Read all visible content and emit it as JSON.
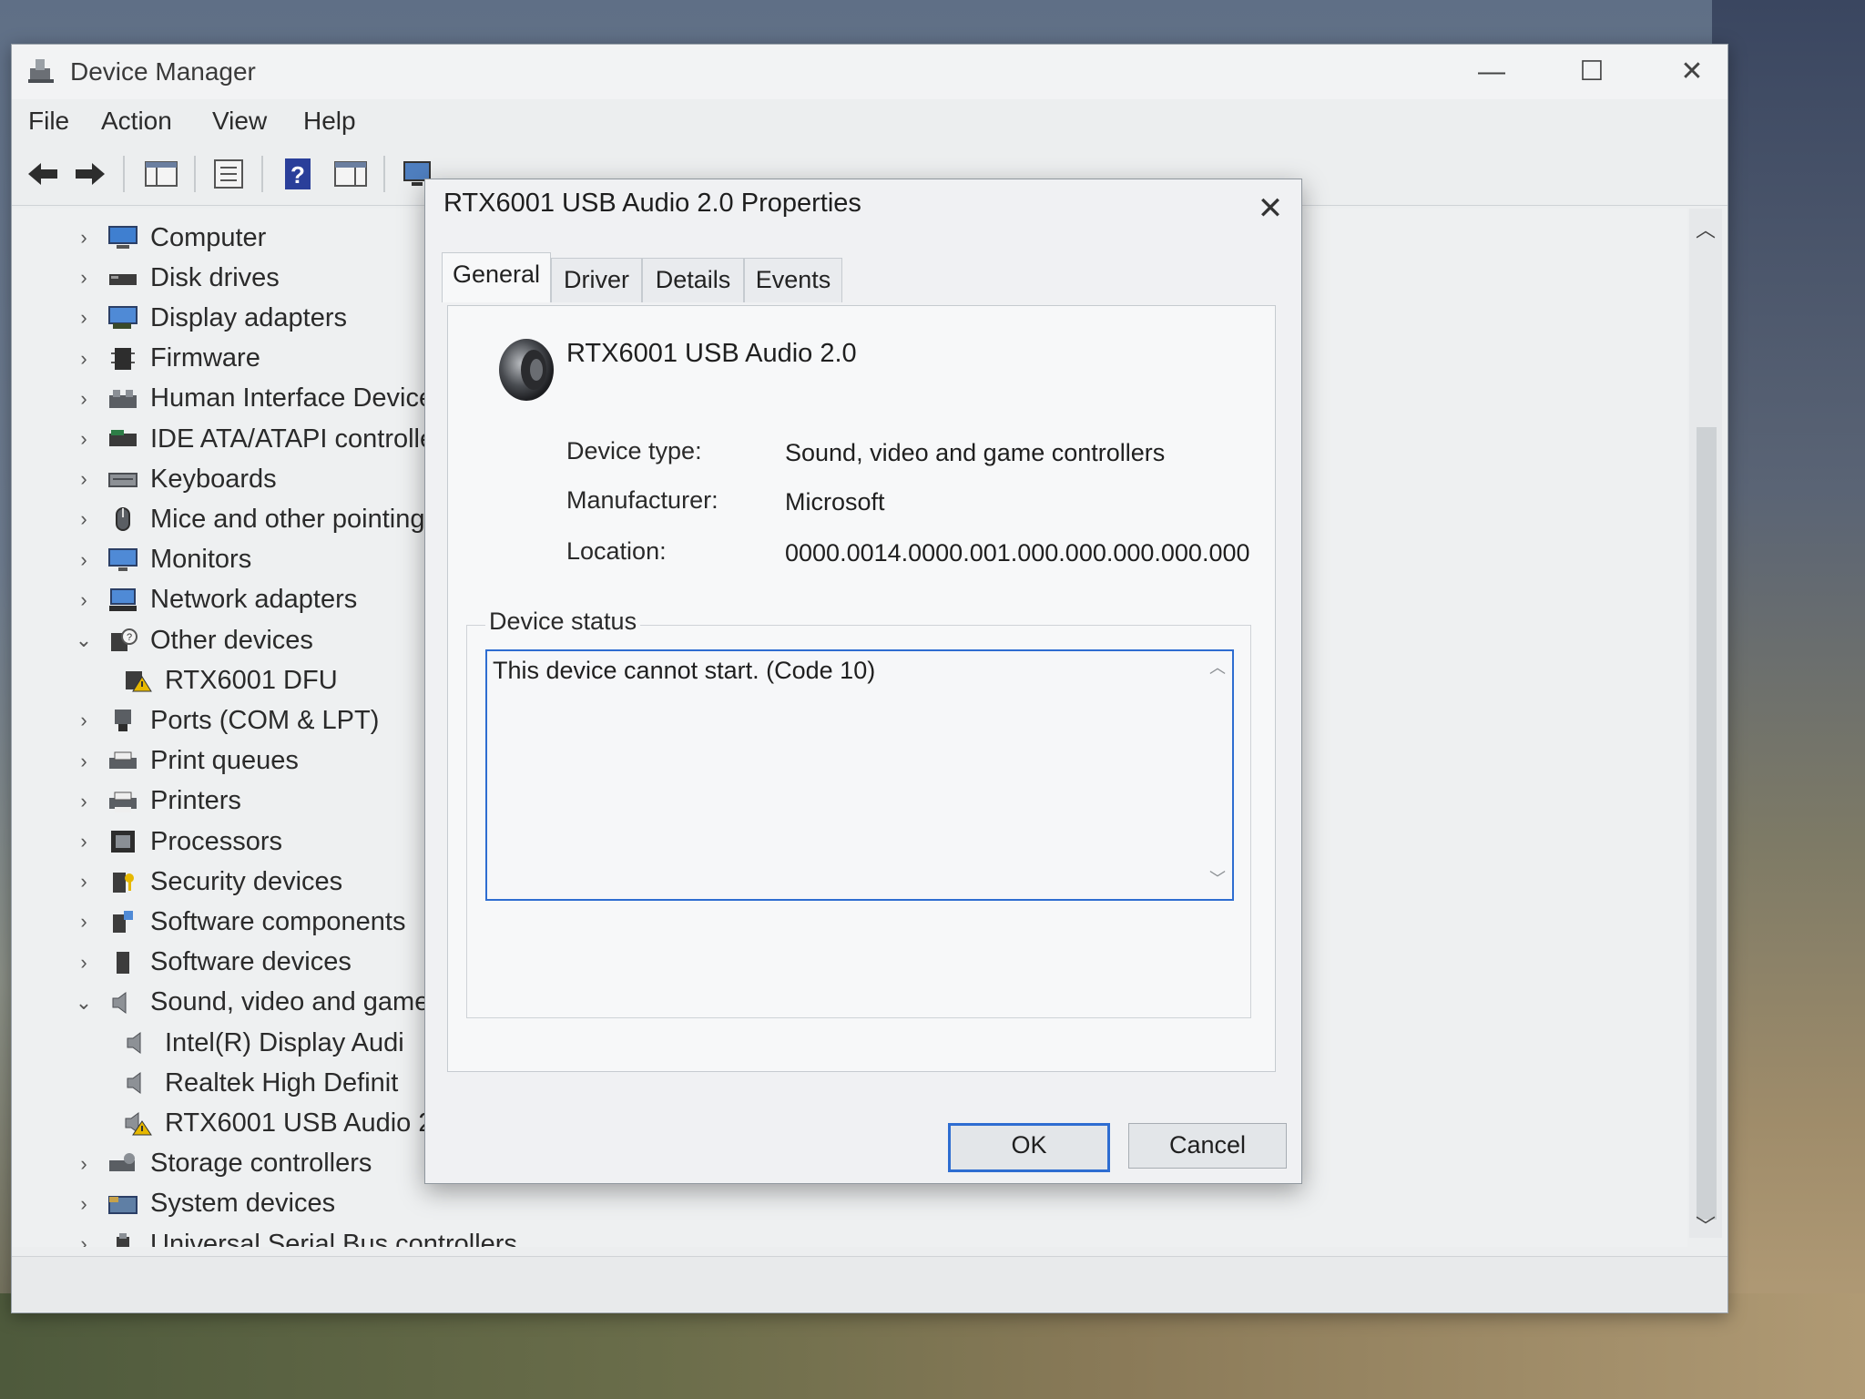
{
  "dm": {
    "title": "Device Manager",
    "window_controls": {
      "minimize": "—",
      "maximize": "☐",
      "close": "✕"
    },
    "menu": [
      "File",
      "Action",
      "View",
      "Help"
    ],
    "tree": [
      {
        "label": "Computer",
        "chev": "›",
        "icon": "computer-icon",
        "indent": 0
      },
      {
        "label": "Disk drives",
        "chev": "›",
        "icon": "disk-drive-icon",
        "indent": 0
      },
      {
        "label": "Display adapters",
        "chev": "›",
        "icon": "display-adapter-icon",
        "indent": 0
      },
      {
        "label": "Firmware",
        "chev": "›",
        "icon": "firmware-icon",
        "indent": 0
      },
      {
        "label": "Human Interface Device",
        "chev": "›",
        "icon": "hid-icon",
        "indent": 0
      },
      {
        "label": "IDE ATA/ATAPI controlle",
        "chev": "›",
        "icon": "ide-controller-icon",
        "indent": 0
      },
      {
        "label": "Keyboards",
        "chev": "›",
        "icon": "keyboard-icon",
        "indent": 0
      },
      {
        "label": "Mice and other pointing",
        "chev": "›",
        "icon": "mouse-icon",
        "indent": 0
      },
      {
        "label": "Monitors",
        "chev": "›",
        "icon": "monitor-icon",
        "indent": 0
      },
      {
        "label": "Network adapters",
        "chev": "›",
        "icon": "network-adapter-icon",
        "indent": 0
      },
      {
        "label": "Other devices",
        "chev": "⌄",
        "icon": "other-devices-icon",
        "indent": 0
      },
      {
        "label": "RTX6001 DFU",
        "chev": "",
        "icon": "warning-device-icon",
        "indent": 1
      },
      {
        "label": "Ports (COM & LPT)",
        "chev": "›",
        "icon": "port-icon",
        "indent": 0
      },
      {
        "label": "Print queues",
        "chev": "›",
        "icon": "print-queue-icon",
        "indent": 0
      },
      {
        "label": "Printers",
        "chev": "›",
        "icon": "printer-icon",
        "indent": 0
      },
      {
        "label": "Processors",
        "chev": "›",
        "icon": "processor-icon",
        "indent": 0
      },
      {
        "label": "Security devices",
        "chev": "›",
        "icon": "security-device-icon",
        "indent": 0
      },
      {
        "label": "Software components",
        "chev": "›",
        "icon": "software-component-icon",
        "indent": 0
      },
      {
        "label": "Software devices",
        "chev": "›",
        "icon": "software-device-icon",
        "indent": 0
      },
      {
        "label": "Sound, video and game",
        "chev": "⌄",
        "icon": "speaker-icon",
        "indent": 0
      },
      {
        "label": "Intel(R) Display Audi",
        "chev": "",
        "icon": "speaker-icon",
        "indent": 1
      },
      {
        "label": "Realtek High Definit",
        "chev": "",
        "icon": "speaker-icon",
        "indent": 1
      },
      {
        "label": "RTX6001 USB Audio 2",
        "chev": "",
        "icon": "warning-speaker-icon",
        "indent": 1
      },
      {
        "label": "Storage controllers",
        "chev": "›",
        "icon": "storage-controller-icon",
        "indent": 0
      },
      {
        "label": "System devices",
        "chev": "›",
        "icon": "system-devices-icon",
        "indent": 0
      },
      {
        "label": "Universal Serial Bus controllers",
        "chev": "›",
        "icon": "usb-icon",
        "indent": 0
      }
    ]
  },
  "dialog": {
    "title": "RTX6001 USB Audio 2.0 Properties",
    "close_symbol": "✕",
    "tabs": [
      "General",
      "Driver",
      "Details",
      "Events"
    ],
    "active_tab": "General",
    "device_name": "RTX6001 USB Audio 2.0",
    "props": [
      {
        "label": "Device type:",
        "value": "Sound, video and game controllers"
      },
      {
        "label": "Manufacturer:",
        "value": "Microsoft"
      },
      {
        "label": "Location:",
        "value": "0000.0014.0000.001.000.000.000.000.000"
      }
    ],
    "status_legend": "Device status",
    "status_text": "This device cannot start. (Code 10)",
    "ok_label": "OK",
    "cancel_label": "Cancel"
  },
  "colors": {
    "accent": "#2e6dd1",
    "warning": "#e6b800"
  }
}
